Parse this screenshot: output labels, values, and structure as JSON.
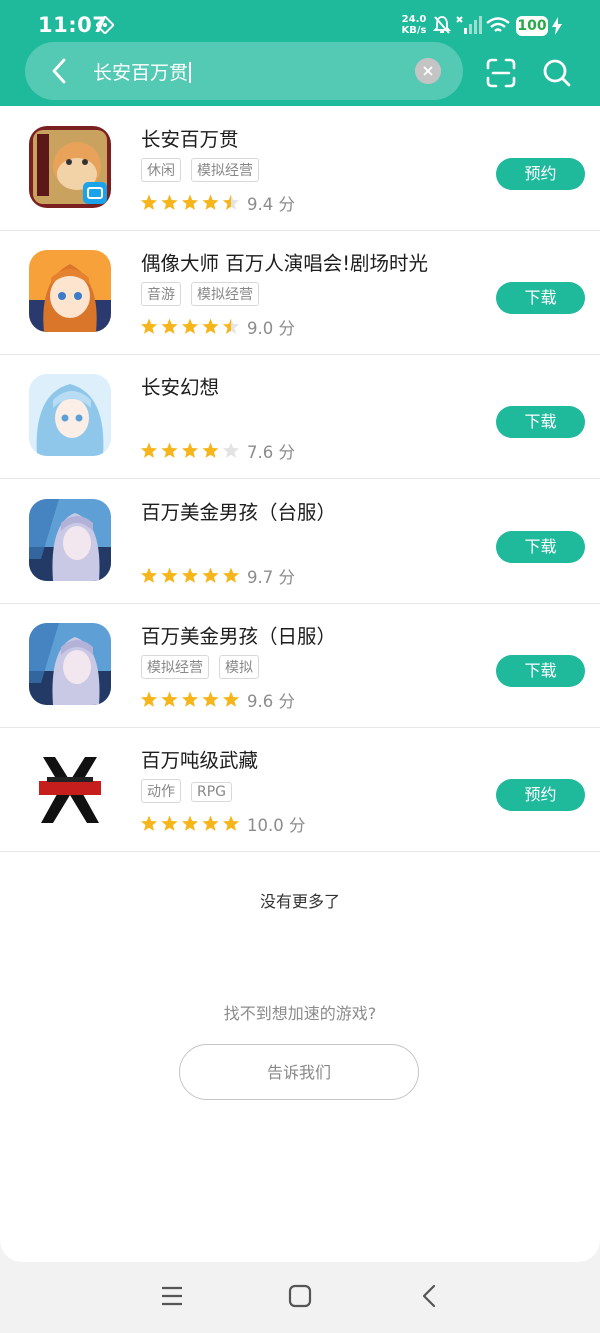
{
  "status_bar": {
    "time": "11:07",
    "net_speed_value": "24.0",
    "net_speed_unit": "KB/s",
    "battery": "100"
  },
  "search": {
    "query": "长安百万贯",
    "back_icon": "chevron-left-icon",
    "clear_icon": "close-icon",
    "scan_icon": "scan-icon",
    "search_icon": "search-icon"
  },
  "games": [
    {
      "title": "长安百万贯",
      "tags": [
        "休闲",
        "模拟经营"
      ],
      "rating": 4.5,
      "score": "9.4 分",
      "action": "预约"
    },
    {
      "title": "偶像大师 百万人演唱会!剧场时光",
      "tags": [
        "音游",
        "模拟经营"
      ],
      "rating": 4.5,
      "score": "9.0 分",
      "action": "下载"
    },
    {
      "title": "长安幻想",
      "tags": [],
      "rating": 4,
      "score": "7.6 分",
      "action": "下载"
    },
    {
      "title": "百万美金男孩（台服）",
      "tags": [],
      "rating": 5,
      "score": "9.7 分",
      "action": "下载"
    },
    {
      "title": "百万美金男孩（日服）",
      "tags": [
        "模拟经营",
        "模拟"
      ],
      "rating": 5,
      "score": "9.6 分",
      "action": "下载"
    },
    {
      "title": "百万吨级武藏",
      "tags": [
        "动作",
        "RPG"
      ],
      "rating": 5,
      "score": "10.0 分",
      "action": "预约"
    }
  ],
  "footer": {
    "no_more": "没有更多了",
    "not_found": "找不到想加速的游戏?",
    "tell_us": "告诉我们"
  },
  "colors": {
    "accent": "#1fb99c",
    "star": "#f5b51b",
    "star_empty": "#e3e3e3"
  },
  "nav_bar": {
    "menu_icon": "menu-icon",
    "home_icon": "home-square-icon",
    "back_icon": "back-triangle-icon"
  }
}
